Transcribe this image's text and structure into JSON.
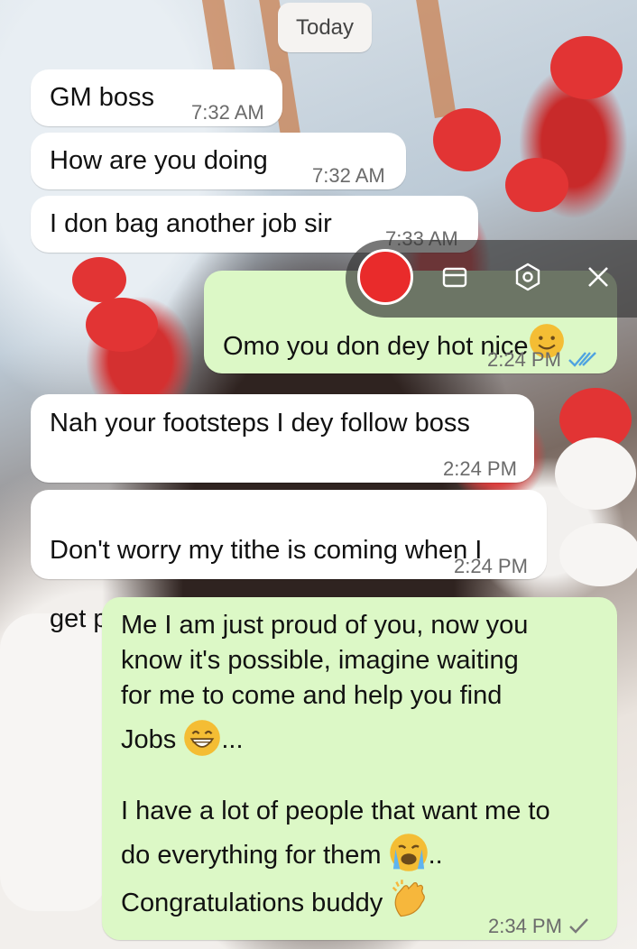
{
  "date_divider": "Today",
  "messages": [
    {
      "text": "GM boss",
      "time": "7:32 AM",
      "direction": "incoming"
    },
    {
      "text": "How are you doing",
      "time": "7:32 AM",
      "direction": "incoming"
    },
    {
      "text": "I don bag another job sir",
      "time": "7:33 AM",
      "direction": "incoming"
    },
    {
      "text": "Omo you don dey hot nice",
      "time": "2:24 PM",
      "direction": "outgoing",
      "status": "read"
    },
    {
      "text": "Nah your footsteps I dey follow boss",
      "time": "2:24 PM",
      "direction": "incoming"
    },
    {
      "line1": "Don't worry my tithe is coming when I",
      "line2": "get paid",
      "time": "2:24 PM",
      "direction": "incoming"
    },
    {
      "lines": [
        "Me I am just proud of you, now you",
        "know it's possible, imagine waiting",
        "for me to come and help you find",
        "Jobs",
        "...",
        "I have a lot of people that want me to",
        "do everything for them",
        "..",
        "Congratulations buddy"
      ],
      "time": "2:34 PM",
      "direction": "outgoing",
      "status": "sent"
    }
  ],
  "emojis": [
    "smiling-face-emoji",
    "grinning-face-emoji",
    "crying-face-emoji",
    "clapping-hands-emoji"
  ],
  "recording_toolbar": {
    "icons": [
      "record-button",
      "folder-icon",
      "settings-icon",
      "close-icon"
    ]
  },
  "colors": {
    "incoming_bubble": "#ffffff",
    "outgoing_bubble": "#dcf8c6",
    "read_ticks": "#4fa3e0",
    "record_red": "#e92b2b"
  }
}
